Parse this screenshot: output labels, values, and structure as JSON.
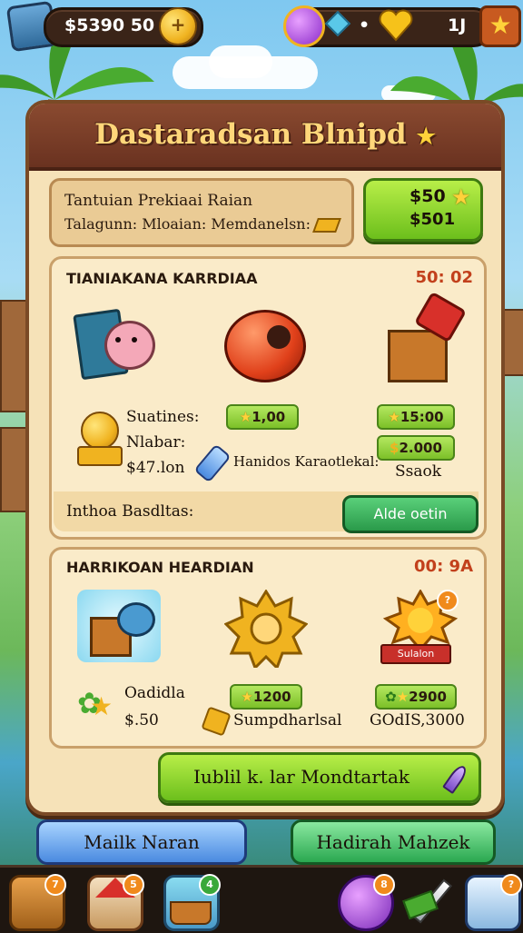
{
  "topbar": {
    "currency_amount": "$5390 50",
    "gems_separator": "•",
    "hearts_count": "1J"
  },
  "panel": {
    "title": "Dastaradsan Blnipd",
    "info_line1": "Tantuian Prekiaai Raian",
    "info_line2": "Talagunn: Mloaian: Memdanelsn:",
    "price_button_line1": "$50",
    "price_button_line2": "$501"
  },
  "section1": {
    "title": "TIANIAKANA KARRDIAA",
    "timer": "50: 02",
    "label_sualines": "Suatines:",
    "label_nlabar": "Nlabar:",
    "value_price": "$47.lon",
    "tag1": "1,00",
    "tag2": "15:00",
    "tag3": "2.000",
    "handles_text": "Hanidos Karaotlekal:",
    "sack_text": "Ssaok",
    "footer_label": "Inthoa Basdltas:",
    "action_button": "Alde oetin"
  },
  "section2": {
    "title": "HARRIKOAN HEARDIAN",
    "timer": "00: 9A",
    "label_oadidla": "Oadidla",
    "value_price": "$.50",
    "tag1": "1200",
    "tag2": "2900",
    "sumph_text": "Sumpdharlsal",
    "gold_text": "GOdIS,3000",
    "sun_banner": "Sulalon"
  },
  "main_button": "Iublil k. lar Mondtartak",
  "bottom_buttons": {
    "left": "Mailk Naran",
    "right": "Hadirah Mahzek"
  },
  "nav_badges": [
    "7",
    "5",
    "4",
    "8",
    "?"
  ]
}
